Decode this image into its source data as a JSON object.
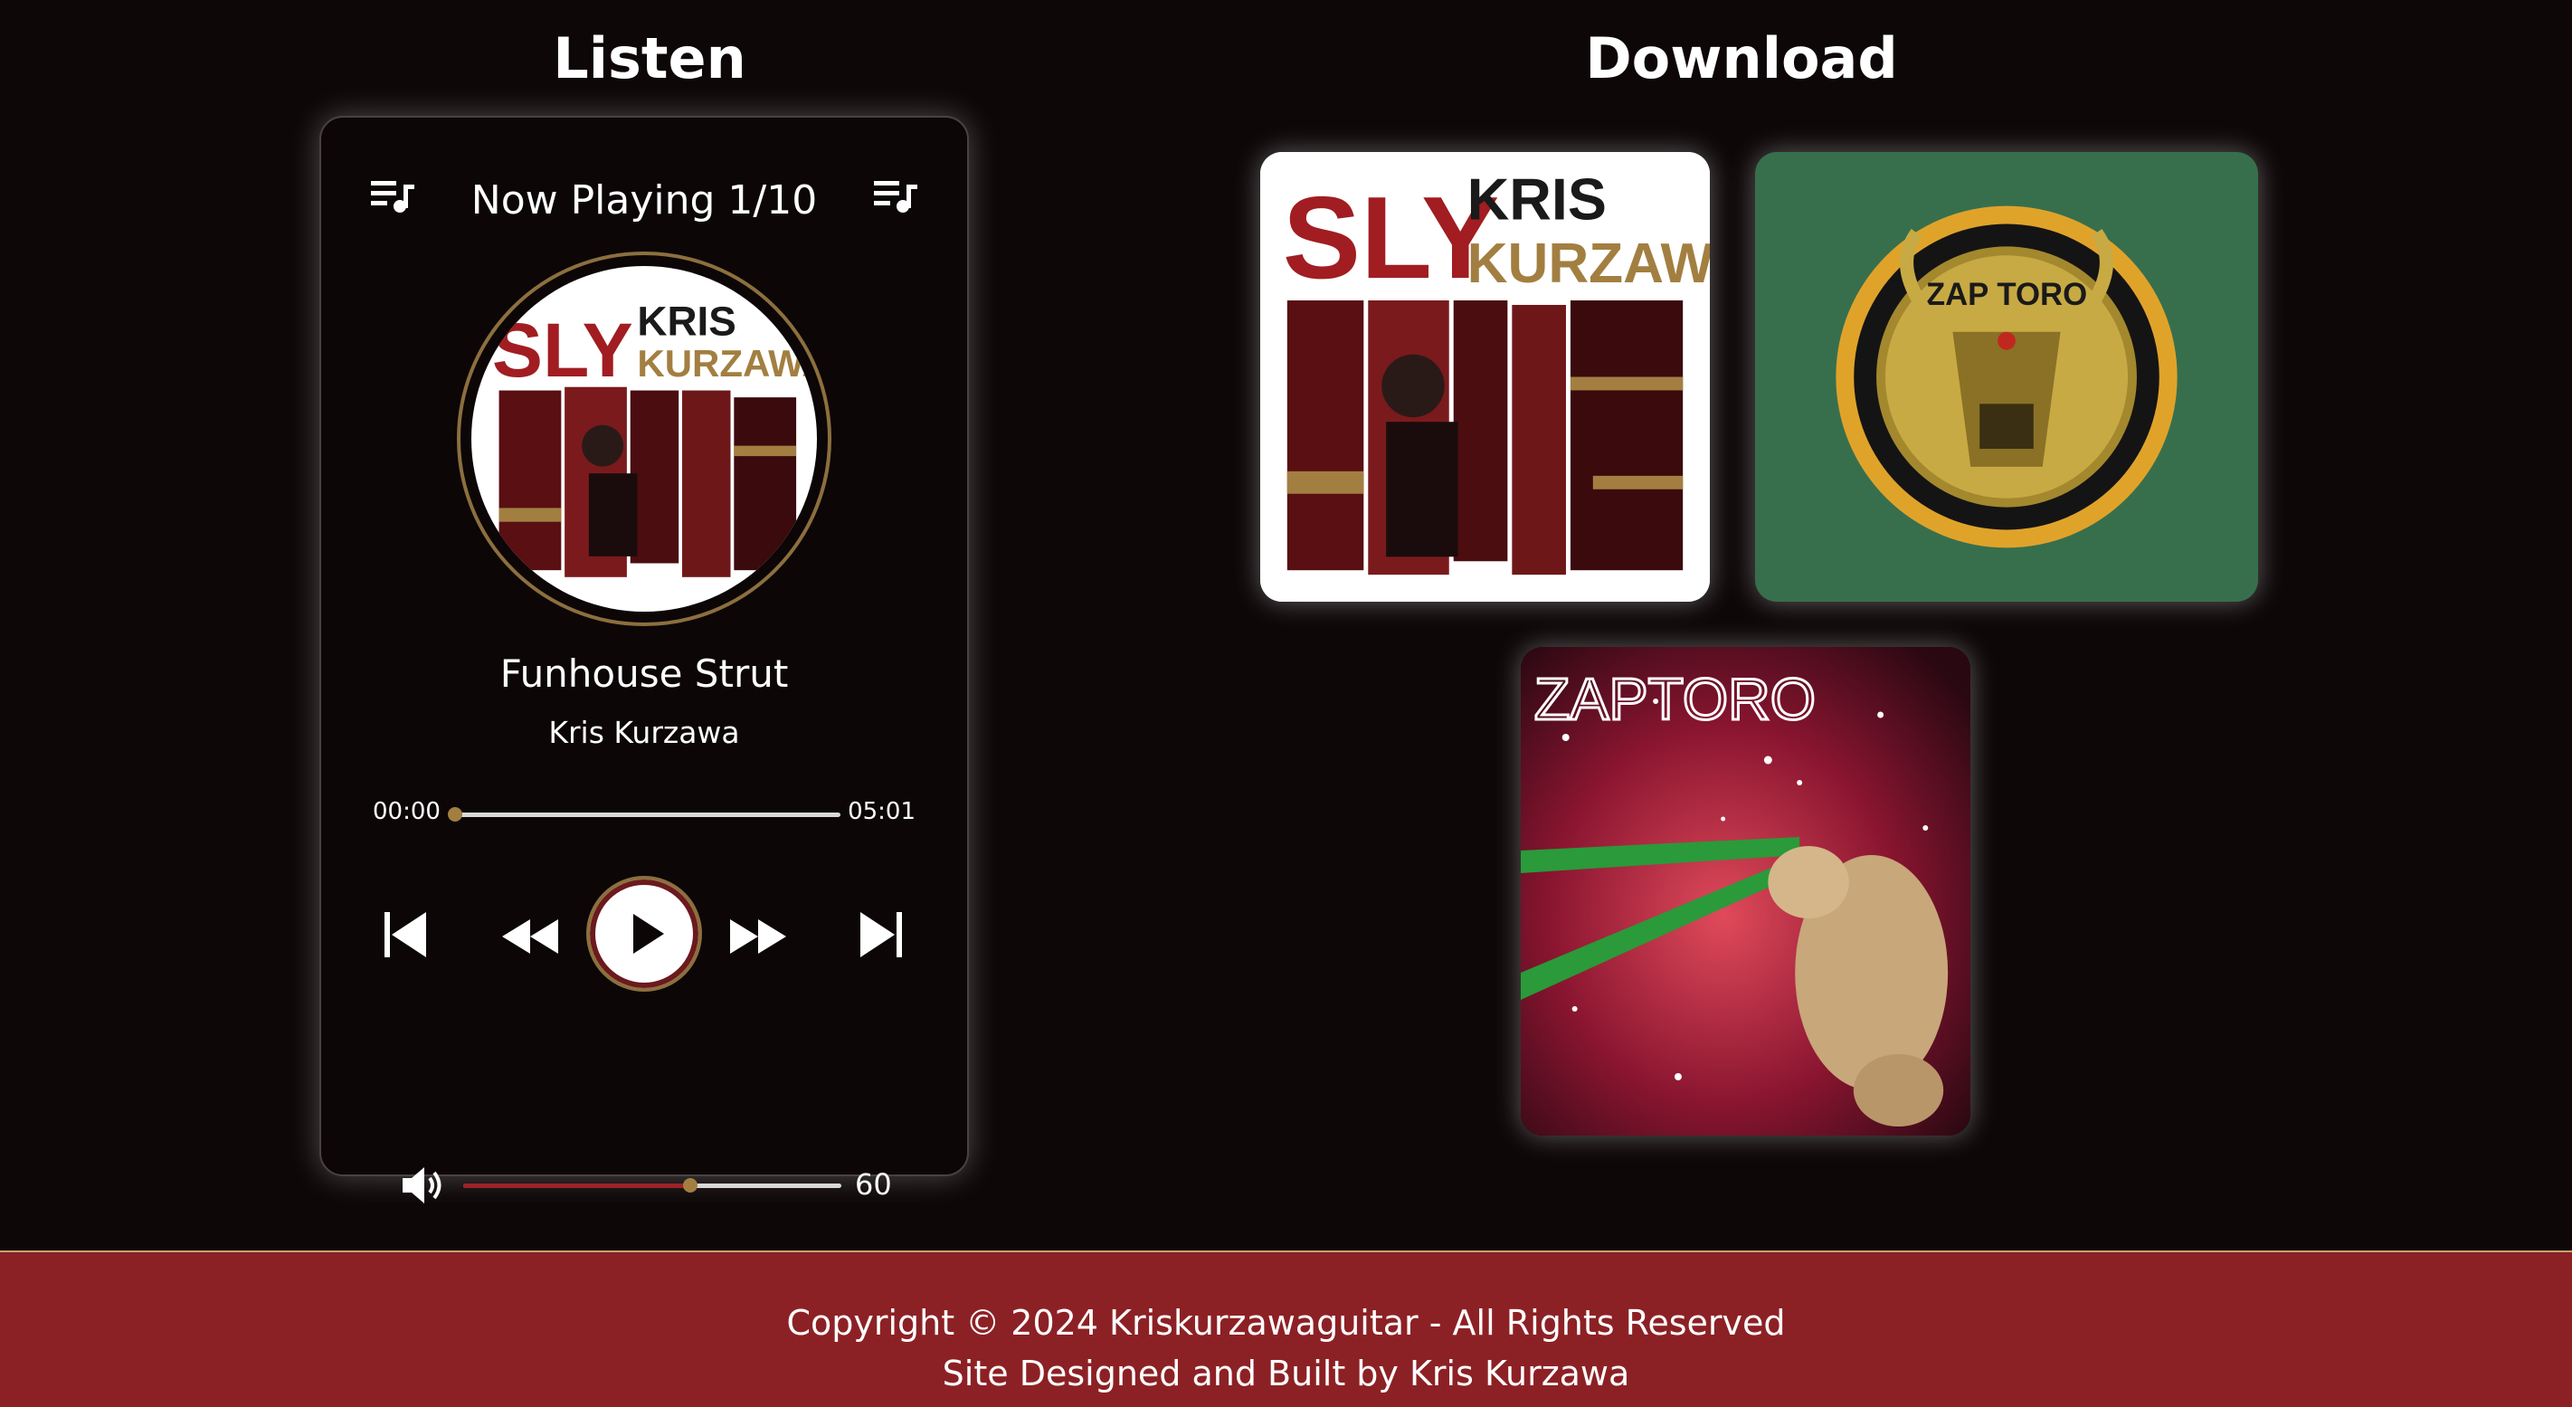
{
  "sections": {
    "listen_title": "Listen",
    "download_title": "Download"
  },
  "player": {
    "now_playing": "Now Playing 1/10",
    "track_title": "Funhouse Strut",
    "track_artist": "Kris Kurzawa",
    "time_current": "00:00",
    "time_total": "05:01",
    "progress_fraction": 0.0,
    "volume": "60",
    "volume_fraction": 0.6,
    "accent_color": "#a27f41",
    "icons": {
      "queue": "queue-music-icon",
      "prev": "skip-previous-icon",
      "rewind": "rewind-icon",
      "play": "play-icon",
      "forward": "fast-forward-icon",
      "next": "skip-next-icon",
      "volume": "volume-icon"
    },
    "cover_text": {
      "sly": "SLY",
      "kris": "KRIS",
      "kurzawa": "KURZAWA"
    }
  },
  "albums": [
    {
      "id": "sly",
      "text_sly": "SLY",
      "text_kris": "KRIS",
      "text_kurzawa": "KURZAWA"
    },
    {
      "id": "zaptoro-green",
      "text": "ZAP TORO"
    },
    {
      "id": "zaptoro-space",
      "text": "ZAPTORO"
    }
  ],
  "footer": {
    "line1": "Copyright © 2024 Kriskurzawaguitar - All Rights Reserved",
    "line2": "Site Designed and Built by Kris Kurzawa",
    "background": "#8c2125"
  }
}
